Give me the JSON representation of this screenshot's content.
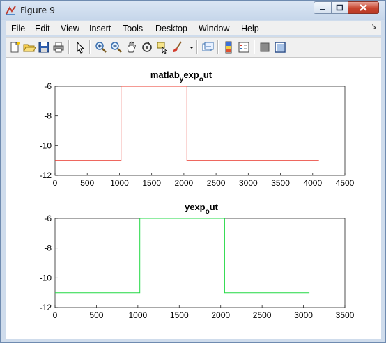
{
  "window": {
    "title": "Figure 9"
  },
  "menu": [
    "File",
    "Edit",
    "View",
    "Insert",
    "Tools",
    "Desktop",
    "Window",
    "Help"
  ],
  "toolbar_icons": [
    "new-figure-icon",
    "open-file-icon",
    "save-icon",
    "print-icon",
    "pointer-icon",
    "zoom-in-icon",
    "zoom-out-icon",
    "pan-icon",
    "rotate-3d-icon",
    "data-cursor-icon",
    "brush-icon",
    "brush-dropdown-icon",
    "link-plot-icon",
    "colorbar-icon",
    "legend-icon",
    "hide-plot-tools-icon",
    "show-plot-tools-icon"
  ],
  "chart_data": [
    {
      "type": "line",
      "title": "matlab_exp_out",
      "title_parts": {
        "a": "matlab",
        "b": "y",
        "c": "exp",
        "d": "o",
        "e": "ut"
      },
      "xlim": [
        0,
        4500
      ],
      "ylim": [
        -12,
        -6
      ],
      "xticks": [
        "0",
        "500",
        "1000",
        "1500",
        "2000",
        "2500",
        "3000",
        "3500",
        "4000",
        "4500"
      ],
      "yticks": [
        "-6",
        "-8",
        "-10",
        "-12"
      ],
      "color": "#e8352a",
      "series": [
        {
          "x": [
            0,
            1024,
            1024,
            2048,
            2048,
            4096
          ],
          "y": [
            -11,
            -11,
            -6,
            -6,
            -11,
            -11
          ]
        }
      ]
    },
    {
      "type": "line",
      "title": "yexp_out",
      "title_parts": {
        "a": "yexp",
        "b": "o",
        "c": "ut"
      },
      "xlim": [
        0,
        3500
      ],
      "ylim": [
        -12,
        -6
      ],
      "xticks": [
        "0",
        "500",
        "1000",
        "1500",
        "2000",
        "2500",
        "3000",
        "3500"
      ],
      "yticks": [
        "-6",
        "-8",
        "-10",
        "-12"
      ],
      "color": "#22d944",
      "series": [
        {
          "x": [
            0,
            1024,
            1024,
            2048,
            2048,
            3072
          ],
          "y": [
            -11,
            -11,
            -6,
            -6,
            -11,
            -11
          ]
        }
      ]
    }
  ]
}
